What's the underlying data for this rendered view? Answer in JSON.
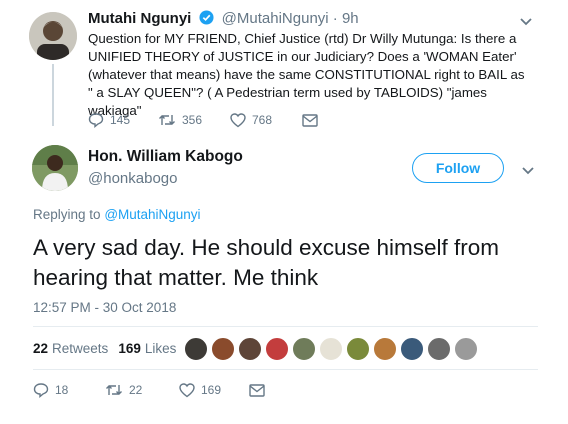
{
  "parent_tweet": {
    "author_name": "Mutahi Ngunyi",
    "handle": "@MutahiNgunyi",
    "separator": "·",
    "time": "9h",
    "text": "Question for MY FRIEND, Chief Justice (rtd) Dr Willy Mutunga: Is there a UNIFIED THEORY of JUSTICE in our Judiciary? Does a 'WOMAN Eater' (whatever that means) have the same CONSTITUTIONAL right to BAIL as \" a SLAY QUEEN\"? ( A Pedestrian term used by TABLOIDS) \"james wakiaga\"",
    "replies": "145",
    "retweets": "356",
    "likes": "768",
    "icons": [
      "verified-badge-icon",
      "caret-down-icon",
      "reply-icon",
      "retweet-icon",
      "heart-icon",
      "message-icon"
    ]
  },
  "reply_tweet": {
    "author_name": "Hon. William Kabogo",
    "handle": "@honkabogo",
    "follow_label": "Follow",
    "replying_prefix": "Replying to",
    "replying_to": "@MutahiNgunyi",
    "text": "A very sad day. He should excuse himself from hearing that matter. Me think",
    "timestamp": "12:57 PM - 30 Oct 2018",
    "retweet_count": "22",
    "retweet_label": "Retweets",
    "like_count": "169",
    "like_label": "Likes",
    "replies": "18",
    "retweets": "22",
    "likes": "169",
    "accent_color": "#1da1f2"
  }
}
